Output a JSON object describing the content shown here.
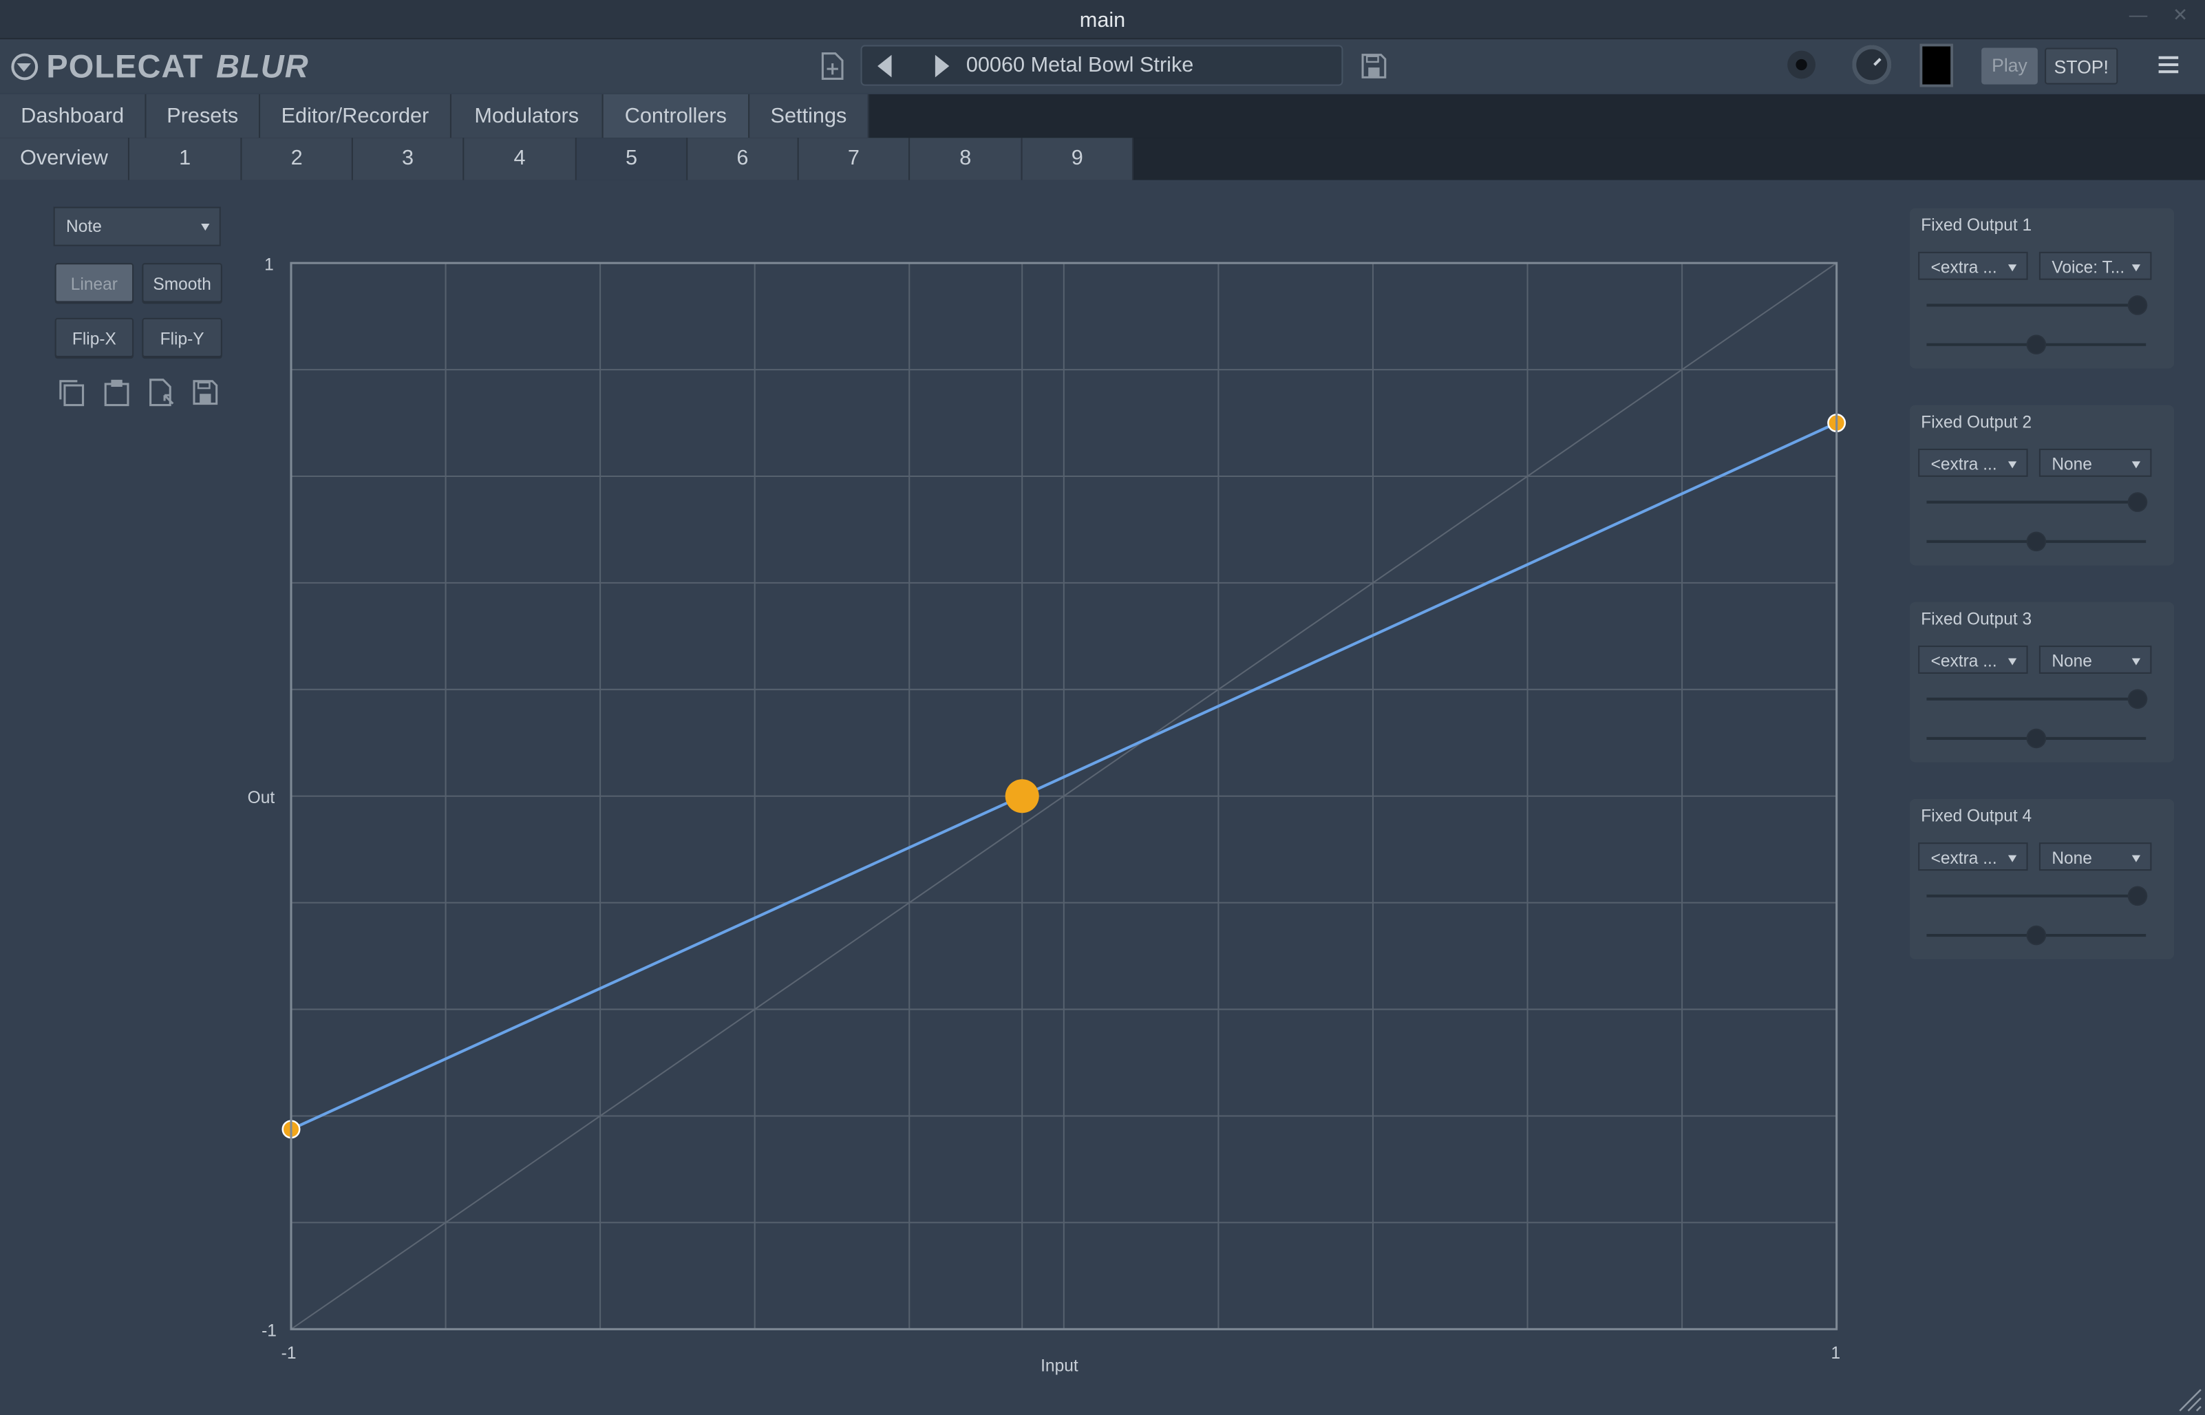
{
  "window": {
    "title": "main"
  },
  "toolbar": {
    "logo_main": "POLECAT",
    "logo_sub": "BLUR",
    "preset_name": "00060 Metal Bowl Strike",
    "play_label": "Play",
    "stop_label": "STOP!"
  },
  "main_tabs": [
    "Dashboard",
    "Presets",
    "Editor/Recorder",
    "Modulators",
    "Controllers",
    "Settings"
  ],
  "active_main_tab": "Controllers",
  "sub_tabs": [
    "Overview",
    "1",
    "2",
    "3",
    "4",
    "5",
    "6",
    "7",
    "8",
    "9"
  ],
  "active_sub_tab": "5",
  "curve_editor": {
    "source_select": "Note",
    "linear_label": "Linear",
    "smooth_label": "Smooth",
    "flipx_label": "Flip-X",
    "flipy_label": "Flip-Y",
    "mode": "Linear",
    "y_max_label": "1",
    "y_min_label": "-1",
    "x_min_label": "-1",
    "x_max_label": "1",
    "y_axis_label": "Out",
    "x_axis_label": "Input"
  },
  "chart_data": {
    "type": "line",
    "x_range": [
      -1,
      1
    ],
    "y_range": [
      -1,
      1
    ],
    "grid": true,
    "points": [
      {
        "x": -1.0,
        "y": -0.625
      },
      {
        "x": -0.054,
        "y": 0.0
      },
      {
        "x": 1.0,
        "y": 0.7
      }
    ],
    "reference_diagonal": true,
    "line_color": "#6aa3e8",
    "point_color": "#f2a61b"
  },
  "fixed_outputs": [
    {
      "title": "Fixed Output 1",
      "select1": "<extra ...",
      "select2": "Voice: T...",
      "slider1": 1.0,
      "slider2": 0.5
    },
    {
      "title": "Fixed Output 2",
      "select1": "<extra ...",
      "select2": "None",
      "slider1": 1.0,
      "slider2": 0.5
    },
    {
      "title": "Fixed Output 3",
      "select1": "<extra ...",
      "select2": "None",
      "slider1": 1.0,
      "slider2": 0.5
    },
    {
      "title": "Fixed Output 4",
      "select1": "<extra ...",
      "select2": "None",
      "slider1": 1.0,
      "slider2": 0.5
    }
  ]
}
